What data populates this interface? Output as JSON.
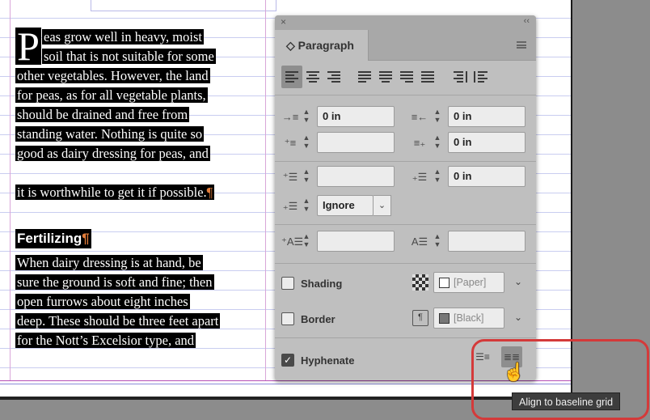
{
  "document": {
    "body_lines": [
      "eas grow well in heavy, moist",
      "soil that is not suitable for some",
      "other vegetables. However, the land",
      "for peas, as for all vegetable plants,",
      "should be drained and free from",
      "standing water. Nothing is quite so",
      "good as dairy dressing for peas, and",
      "it is worthwhile to get it if possible."
    ],
    "drop_cap": "P",
    "pilcrow": "¶",
    "heading": "Fertilizing",
    "second_lines": [
      "When dairy dressing is at hand, be",
      "sure the ground is soft and fine; then",
      "open furrows about eight inches",
      "deep. These should be three feet apart",
      "for the Nott’s Excelsior type, and"
    ],
    "highlight_color": "#000000",
    "text_color": "#ffffff",
    "pilcrow_color": "#e07b39"
  },
  "panel": {
    "close_glyph": "×",
    "collapse_glyph": "‹‹",
    "tab_chevron": "◇",
    "tab_label": "Paragraph",
    "left_indent": "0 in",
    "right_indent": "0 in",
    "last_line_right_indent": "0 in",
    "space_after": "0 in",
    "first_line_indent": "",
    "space_before": "",
    "drop_cap_lines": "",
    "drop_cap_chars": "",
    "grid_mode": "Ignore",
    "shading_label": "Shading",
    "shading_swatch": "[Paper]",
    "border_label": "Border",
    "border_swatch": "[Black]",
    "hyphenate_label": "Hyphenate",
    "hyphenate_checked": true,
    "shading_checked": false,
    "border_checked": false
  },
  "tooltip": "Align to baseline grid",
  "colors": {
    "panel_bg": "#bfbfbf",
    "callout": "#d43a3a",
    "pasteboard": "#8c8c8c"
  }
}
